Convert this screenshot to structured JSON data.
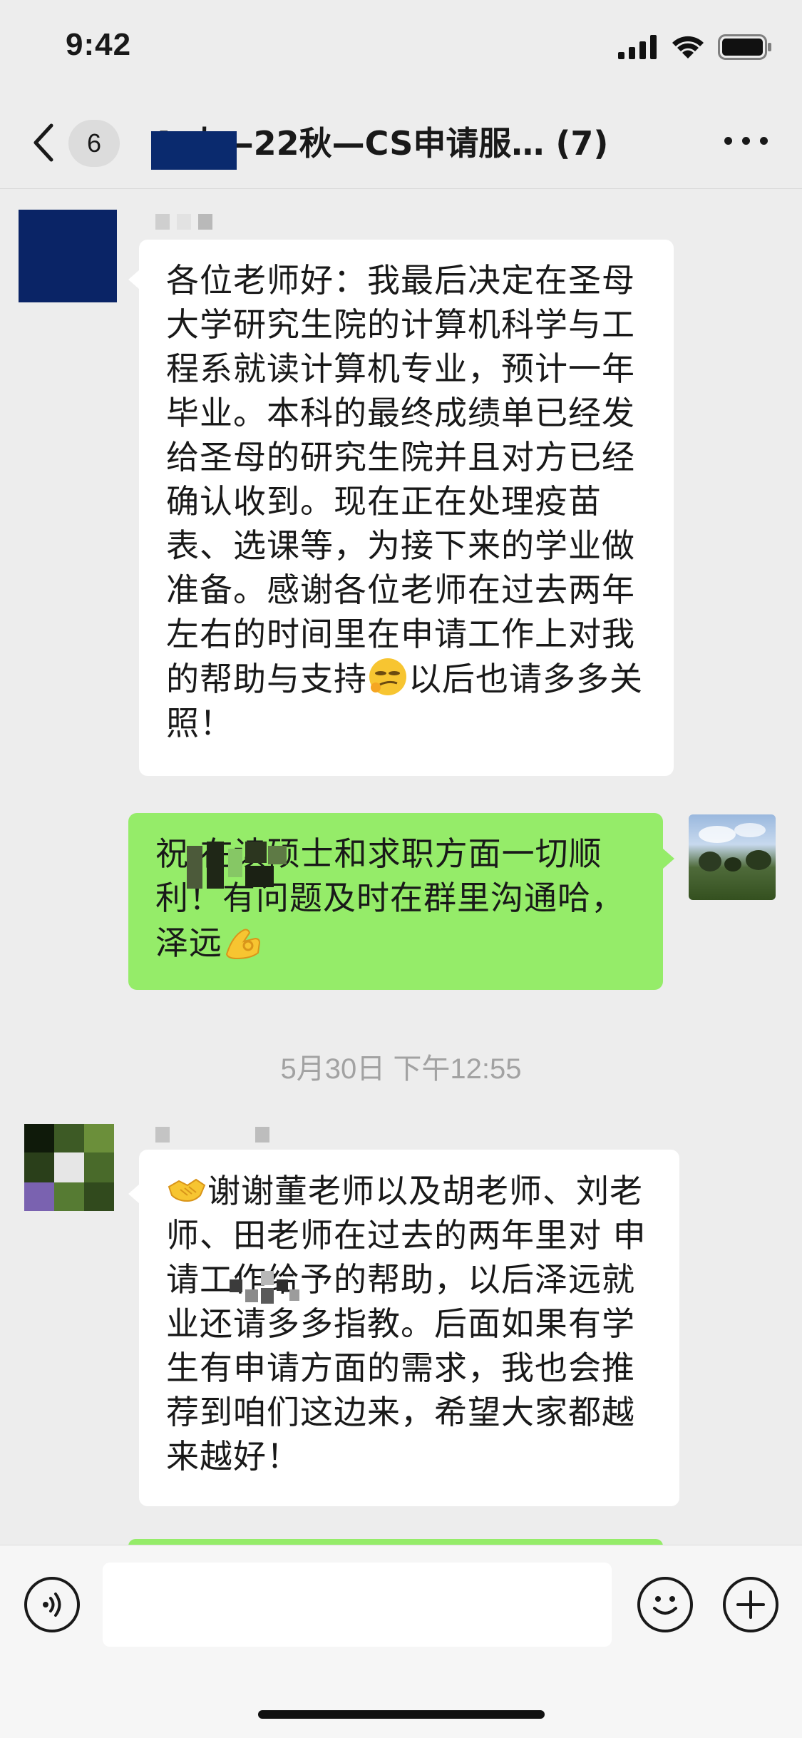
{
  "status_bar": {
    "time": "9:42"
  },
  "nav": {
    "unread_count": "6",
    "title": "A  大—22秋—CS申请服…   (7)"
  },
  "messages": [
    {
      "side": "left",
      "text": "各位老师好：我最后决定在圣母大学研究生院的计算机科学与工程系就读计算机专业，预计一年毕业。本科的最终成绩单已经发给圣母的研究生院并且对方已经确认收到。现在正在处理疫苗表、选课等，为接下来的学业做准备。感谢各位老师在过去两年左右的时间里在申请工作上对我的帮助与支持",
      "text_after_emoji": "以后也请多多关照！"
    },
    {
      "side": "right",
      "text": "祝        在读硕士和求职方面一切顺利！有问题及时在群里沟通哈，泽远"
    },
    {
      "side": "left",
      "text_after_emoji": "谢谢董老师以及胡老师、刘老师、田老师在过去的两年里对      申请工作给予的帮助，以后泽远就业还请多多指教。后面如果有学生有申请方面的需求，我也会推荐到咱们这边来，希望大家都越来越好！"
    }
  ],
  "timestamp": "5月30日 下午12:55",
  "colors": {
    "background": "#ededed",
    "green_bubble": "#95ec69",
    "white_bubble": "#ffffff",
    "timestamp_gray": "#a2a2a2"
  },
  "icons": {
    "back": "chevron-left-icon",
    "more": "more-dots-icon",
    "voice": "voice-icon",
    "emoji": "emoji-face-icon",
    "plus": "plus-icon"
  }
}
